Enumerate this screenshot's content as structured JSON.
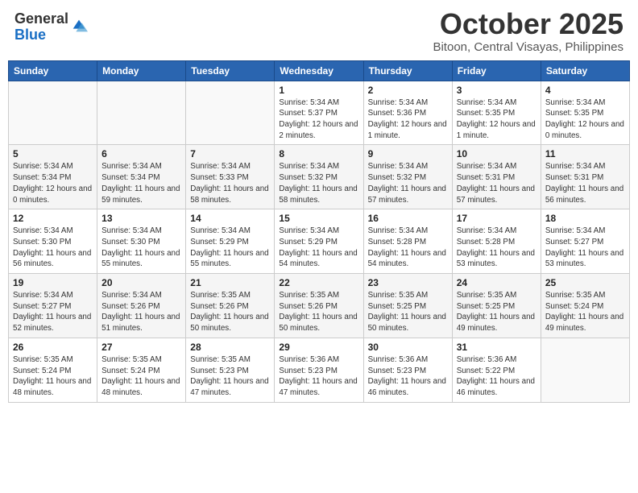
{
  "logo": {
    "general": "General",
    "blue": "Blue"
  },
  "header": {
    "month_title": "October 2025",
    "subtitle": "Bitoon, Central Visayas, Philippines"
  },
  "weekdays": [
    "Sunday",
    "Monday",
    "Tuesday",
    "Wednesday",
    "Thursday",
    "Friday",
    "Saturday"
  ],
  "weeks": [
    [
      {
        "day": "",
        "sunrise": "",
        "sunset": "",
        "daylight": ""
      },
      {
        "day": "",
        "sunrise": "",
        "sunset": "",
        "daylight": ""
      },
      {
        "day": "",
        "sunrise": "",
        "sunset": "",
        "daylight": ""
      },
      {
        "day": "1",
        "sunrise": "Sunrise: 5:34 AM",
        "sunset": "Sunset: 5:37 PM",
        "daylight": "Daylight: 12 hours and 2 minutes."
      },
      {
        "day": "2",
        "sunrise": "Sunrise: 5:34 AM",
        "sunset": "Sunset: 5:36 PM",
        "daylight": "Daylight: 12 hours and 1 minute."
      },
      {
        "day": "3",
        "sunrise": "Sunrise: 5:34 AM",
        "sunset": "Sunset: 5:35 PM",
        "daylight": "Daylight: 12 hours and 1 minute."
      },
      {
        "day": "4",
        "sunrise": "Sunrise: 5:34 AM",
        "sunset": "Sunset: 5:35 PM",
        "daylight": "Daylight: 12 hours and 0 minutes."
      }
    ],
    [
      {
        "day": "5",
        "sunrise": "Sunrise: 5:34 AM",
        "sunset": "Sunset: 5:34 PM",
        "daylight": "Daylight: 12 hours and 0 minutes."
      },
      {
        "day": "6",
        "sunrise": "Sunrise: 5:34 AM",
        "sunset": "Sunset: 5:34 PM",
        "daylight": "Daylight: 11 hours and 59 minutes."
      },
      {
        "day": "7",
        "sunrise": "Sunrise: 5:34 AM",
        "sunset": "Sunset: 5:33 PM",
        "daylight": "Daylight: 11 hours and 58 minutes."
      },
      {
        "day": "8",
        "sunrise": "Sunrise: 5:34 AM",
        "sunset": "Sunset: 5:32 PM",
        "daylight": "Daylight: 11 hours and 58 minutes."
      },
      {
        "day": "9",
        "sunrise": "Sunrise: 5:34 AM",
        "sunset": "Sunset: 5:32 PM",
        "daylight": "Daylight: 11 hours and 57 minutes."
      },
      {
        "day": "10",
        "sunrise": "Sunrise: 5:34 AM",
        "sunset": "Sunset: 5:31 PM",
        "daylight": "Daylight: 11 hours and 57 minutes."
      },
      {
        "day": "11",
        "sunrise": "Sunrise: 5:34 AM",
        "sunset": "Sunset: 5:31 PM",
        "daylight": "Daylight: 11 hours and 56 minutes."
      }
    ],
    [
      {
        "day": "12",
        "sunrise": "Sunrise: 5:34 AM",
        "sunset": "Sunset: 5:30 PM",
        "daylight": "Daylight: 11 hours and 56 minutes."
      },
      {
        "day": "13",
        "sunrise": "Sunrise: 5:34 AM",
        "sunset": "Sunset: 5:30 PM",
        "daylight": "Daylight: 11 hours and 55 minutes."
      },
      {
        "day": "14",
        "sunrise": "Sunrise: 5:34 AM",
        "sunset": "Sunset: 5:29 PM",
        "daylight": "Daylight: 11 hours and 55 minutes."
      },
      {
        "day": "15",
        "sunrise": "Sunrise: 5:34 AM",
        "sunset": "Sunset: 5:29 PM",
        "daylight": "Daylight: 11 hours and 54 minutes."
      },
      {
        "day": "16",
        "sunrise": "Sunrise: 5:34 AM",
        "sunset": "Sunset: 5:28 PM",
        "daylight": "Daylight: 11 hours and 54 minutes."
      },
      {
        "day": "17",
        "sunrise": "Sunrise: 5:34 AM",
        "sunset": "Sunset: 5:28 PM",
        "daylight": "Daylight: 11 hours and 53 minutes."
      },
      {
        "day": "18",
        "sunrise": "Sunrise: 5:34 AM",
        "sunset": "Sunset: 5:27 PM",
        "daylight": "Daylight: 11 hours and 53 minutes."
      }
    ],
    [
      {
        "day": "19",
        "sunrise": "Sunrise: 5:34 AM",
        "sunset": "Sunset: 5:27 PM",
        "daylight": "Daylight: 11 hours and 52 minutes."
      },
      {
        "day": "20",
        "sunrise": "Sunrise: 5:34 AM",
        "sunset": "Sunset: 5:26 PM",
        "daylight": "Daylight: 11 hours and 51 minutes."
      },
      {
        "day": "21",
        "sunrise": "Sunrise: 5:35 AM",
        "sunset": "Sunset: 5:26 PM",
        "daylight": "Daylight: 11 hours and 50 minutes."
      },
      {
        "day": "22",
        "sunrise": "Sunrise: 5:35 AM",
        "sunset": "Sunset: 5:26 PM",
        "daylight": "Daylight: 11 hours and 50 minutes."
      },
      {
        "day": "23",
        "sunrise": "Sunrise: 5:35 AM",
        "sunset": "Sunset: 5:25 PM",
        "daylight": "Daylight: 11 hours and 50 minutes."
      },
      {
        "day": "24",
        "sunrise": "Sunrise: 5:35 AM",
        "sunset": "Sunset: 5:25 PM",
        "daylight": "Daylight: 11 hours and 49 minutes."
      },
      {
        "day": "25",
        "sunrise": "Sunrise: 5:35 AM",
        "sunset": "Sunset: 5:24 PM",
        "daylight": "Daylight: 11 hours and 49 minutes."
      }
    ],
    [
      {
        "day": "26",
        "sunrise": "Sunrise: 5:35 AM",
        "sunset": "Sunset: 5:24 PM",
        "daylight": "Daylight: 11 hours and 48 minutes."
      },
      {
        "day": "27",
        "sunrise": "Sunrise: 5:35 AM",
        "sunset": "Sunset: 5:24 PM",
        "daylight": "Daylight: 11 hours and 48 minutes."
      },
      {
        "day": "28",
        "sunrise": "Sunrise: 5:35 AM",
        "sunset": "Sunset: 5:23 PM",
        "daylight": "Daylight: 11 hours and 47 minutes."
      },
      {
        "day": "29",
        "sunrise": "Sunrise: 5:36 AM",
        "sunset": "Sunset: 5:23 PM",
        "daylight": "Daylight: 11 hours and 47 minutes."
      },
      {
        "day": "30",
        "sunrise": "Sunrise: 5:36 AM",
        "sunset": "Sunset: 5:23 PM",
        "daylight": "Daylight: 11 hours and 46 minutes."
      },
      {
        "day": "31",
        "sunrise": "Sunrise: 5:36 AM",
        "sunset": "Sunset: 5:22 PM",
        "daylight": "Daylight: 11 hours and 46 minutes."
      },
      {
        "day": "",
        "sunrise": "",
        "sunset": "",
        "daylight": ""
      }
    ]
  ]
}
